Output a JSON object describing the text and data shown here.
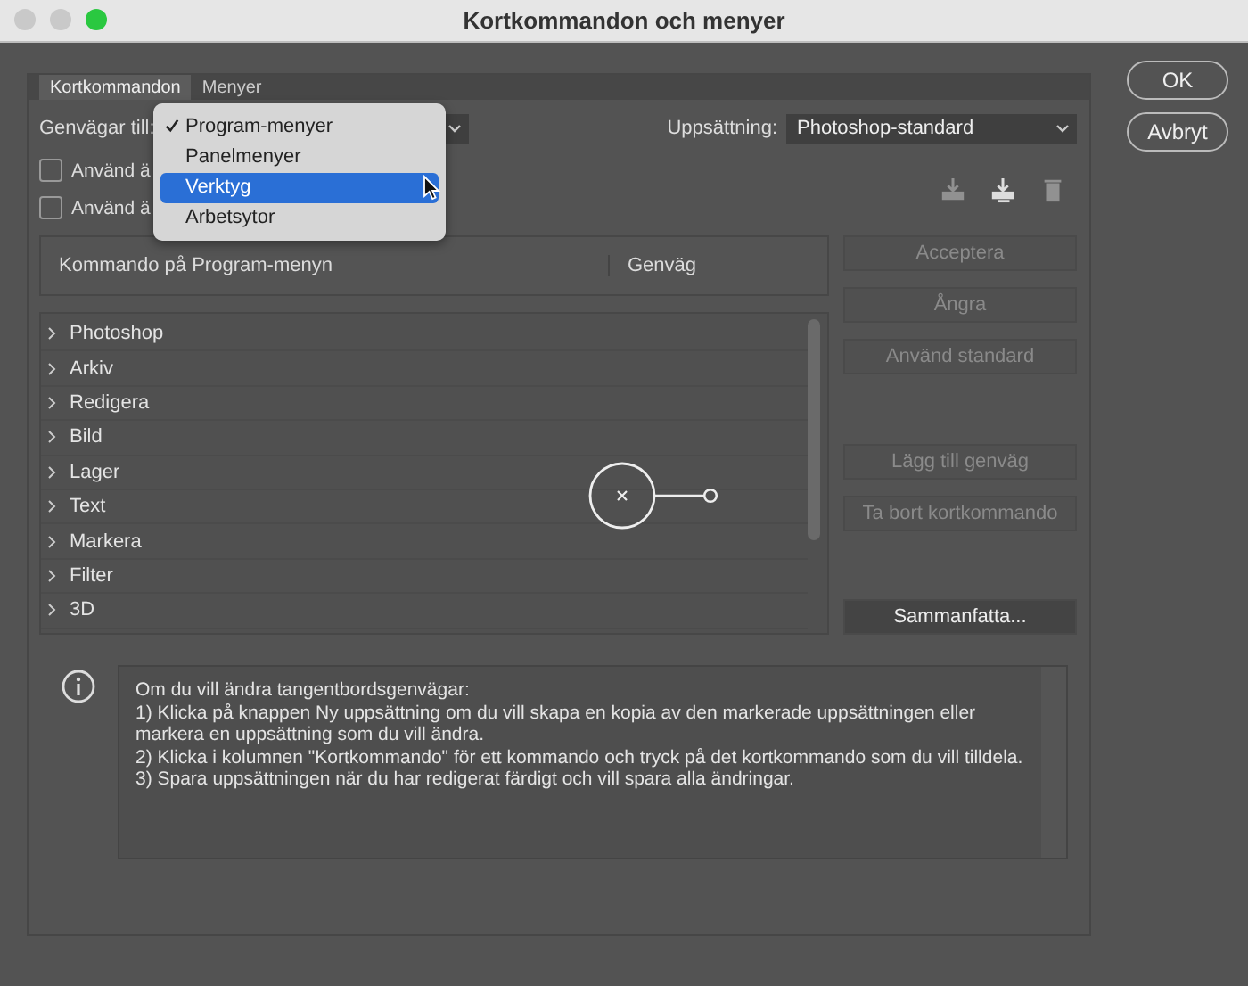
{
  "window": {
    "title": "Kortkommandon och menyer"
  },
  "tabs": [
    {
      "label": "Kortkommandon",
      "selected": true
    },
    {
      "label": "Menyer",
      "selected": false
    }
  ],
  "shortcuts_for": {
    "label": "Genvägar till:"
  },
  "set": {
    "label": "Uppsättning:",
    "value": "Photoshop-standard"
  },
  "checkboxes": [
    {
      "label": "Använd ä",
      "checked": false
    },
    {
      "label": "Använd ä",
      "checked": false
    }
  ],
  "toolbar_icons": [
    {
      "kind": "save",
      "disabled": true
    },
    {
      "kind": "save-as",
      "disabled": false
    },
    {
      "kind": "delete",
      "disabled": true
    }
  ],
  "table": {
    "columns": [
      "Kommando på Program-menyn",
      "Genväg"
    ],
    "rows": [
      {
        "label": "Photoshop",
        "expanded": false
      },
      {
        "label": "Arkiv",
        "expanded": false
      },
      {
        "label": "Redigera",
        "expanded": false
      },
      {
        "label": "Bild",
        "expanded": false
      },
      {
        "label": "Lager",
        "expanded": false
      },
      {
        "label": "Text",
        "expanded": false
      },
      {
        "label": "Markera",
        "expanded": false
      },
      {
        "label": "Filter",
        "expanded": false
      },
      {
        "label": "3D",
        "expanded": false
      }
    ]
  },
  "side_buttons": [
    {
      "label": "Acceptera",
      "disabled": true
    },
    {
      "label": "Ångra",
      "disabled": true
    },
    {
      "label": "Använd standard",
      "disabled": true
    },
    {
      "label": "Lägg till genväg",
      "disabled": true
    },
    {
      "label": "Ta bort kortkommando",
      "disabled": true
    },
    {
      "label": "Sammanfatta...",
      "disabled": false
    }
  ],
  "info_lines": [
    "Om du vill ändra tangentbordsgenvägar:",
    "1) Klicka på knappen Ny uppsättning om du vill skapa en kopia av den markerade uppsättningen eller markera en uppsättning som du vill ändra.",
    "2) Klicka i kolumnen \"Kortkommando\" för ett kommando och tryck på det kortkommando som du vill tilldela.",
    "3) Spara uppsättningen när du har redigerat färdigt och vill spara alla ändringar."
  ],
  "dialog_buttons": [
    "OK",
    "Avbryt"
  ],
  "dropdown_menu": [
    {
      "label": "Program-menyer",
      "checked": true,
      "selected": false
    },
    {
      "label": "Panelmenyer",
      "checked": false,
      "selected": false
    },
    {
      "label": "Verktyg",
      "checked": false,
      "selected": true
    },
    {
      "label": "Arbetsytor",
      "checked": false,
      "selected": false
    }
  ]
}
